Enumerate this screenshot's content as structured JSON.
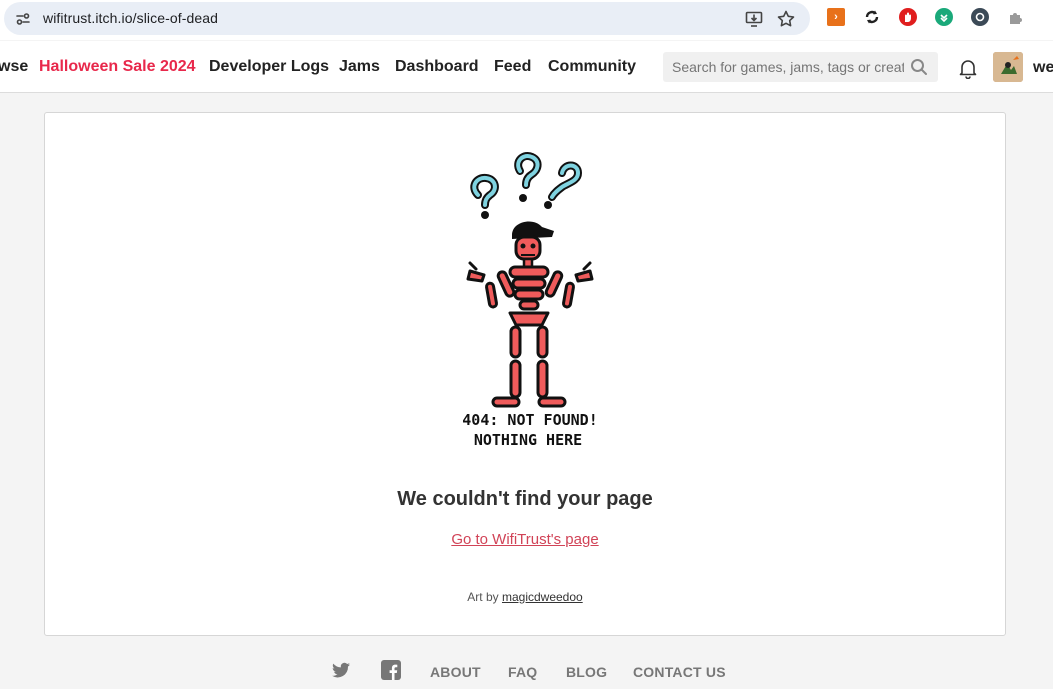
{
  "browser": {
    "url": "wifitrust.itch.io/slice-of-dead",
    "icons": [
      "site-info-icon",
      "install-app-icon",
      "bookmark-star-icon"
    ],
    "extensions": [
      {
        "name": "extension-orange-icon",
        "color": "#e8711a"
      },
      {
        "name": "extension-sync-icon",
        "color": "#222222"
      },
      {
        "name": "extension-red-icon",
        "color": "#e01e1e"
      },
      {
        "name": "extension-green-icon",
        "color": "#1aa97a"
      },
      {
        "name": "extension-gray-icon",
        "color": "#3c4a57"
      },
      {
        "name": "extension-puzzle-icon",
        "color": "#8a8a8a"
      }
    ]
  },
  "header": {
    "nav": [
      {
        "label": "wse",
        "sale": false
      },
      {
        "label": "Halloween Sale 2024",
        "sale": true
      },
      {
        "label": "Developer Logs",
        "sale": false
      },
      {
        "label": "Jams",
        "sale": false
      },
      {
        "label": "Dashboard",
        "sale": false
      },
      {
        "label": "Feed",
        "sale": false
      },
      {
        "label": "Community",
        "sale": false
      }
    ],
    "search_placeholder": "Search for games, jams, tags or creators",
    "username": "we",
    "accent": "#e8284b"
  },
  "main": {
    "illustration_text_line1": "404: NOT FOUND!",
    "illustration_text_line2": "NOTHING HERE",
    "headline": "We couldn't find your page",
    "back_link": "Go to WifiTrust's page",
    "credit_prefix": "Art by",
    "credit_name": "magicdweedoo",
    "link_color": "#d14357",
    "skeleton_color": "#ef5b5b"
  },
  "footer": {
    "icons": [
      "twitter-icon",
      "facebook-icon"
    ],
    "links": [
      "ABOUT",
      "FAQ",
      "BLOG",
      "CONTACT US"
    ]
  }
}
